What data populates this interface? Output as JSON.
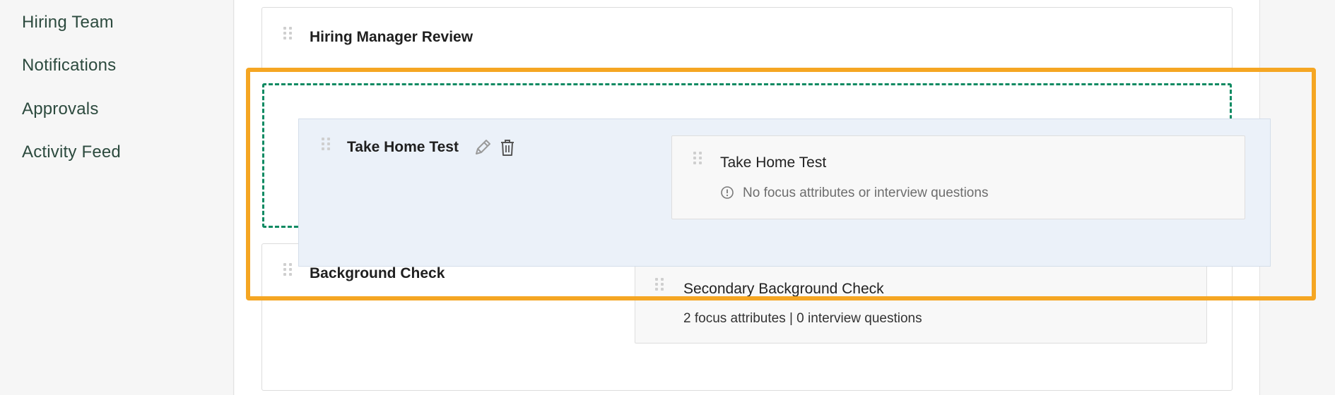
{
  "sidebar": {
    "items": [
      {
        "label": "Hiring Team"
      },
      {
        "label": "Notifications"
      },
      {
        "label": "Approvals"
      },
      {
        "label": "Activity Feed"
      }
    ]
  },
  "stages": {
    "hiring_manager_review": {
      "title": "Hiring Manager Review"
    },
    "background_check": {
      "title": "Background Check"
    }
  },
  "dragging_stage": {
    "title": "Take Home Test",
    "edit_icon": "pencil-icon",
    "delete_icon": "trash-icon",
    "interview": {
      "title": "Take Home Test",
      "info_icon": "info-circle-icon",
      "meta": "No focus attributes or interview questions"
    }
  },
  "background_interview": {
    "title": "Secondary Background Check",
    "meta": "2 focus attributes | 0 interview questions"
  },
  "colors": {
    "accent_green": "#0d8a62",
    "highlight_orange": "#f5a623",
    "drag_bg": "#ebf1f9",
    "nav_text": "#2c4a3e"
  }
}
